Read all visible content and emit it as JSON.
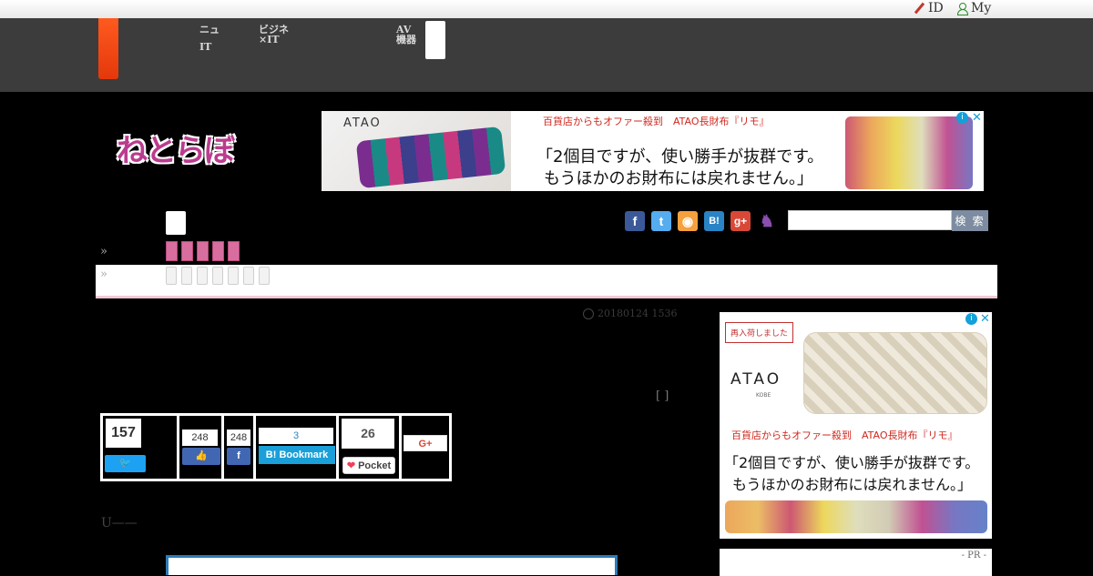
{
  "topbar": {
    "id_link": "ID",
    "my_link": "My"
  },
  "nav": {
    "items": [
      {
        "line1": "ニュ",
        "line2": "IT"
      },
      {
        "line1": "ビジネ",
        "line2": "×IT"
      },
      {
        "line1": "AV",
        "line2": "機器"
      }
    ]
  },
  "logo": {
    "text": "ねとらぼ"
  },
  "ad_top": {
    "brand": "ATAO",
    "headline": "百貨店からもオファー殺到　ATAO長財布『リモ』",
    "copy_line1": "「2個目ですが、使い勝手が抜群です。",
    "copy_line2": "もうほかのお財布には戻れません。」"
  },
  "breadcrumb": {
    "arrow": "»"
  },
  "search": {
    "button_label": "検 索",
    "placeholder": ""
  },
  "social_icons": [
    {
      "name": "facebook",
      "glyph": "f",
      "color": "#3b5998"
    },
    {
      "name": "twitter",
      "glyph": "t",
      "color": "#55acee"
    },
    {
      "name": "rss",
      "glyph": "◉",
      "color": "#f5a13e"
    },
    {
      "name": "hatena",
      "glyph": "B!",
      "color": "#2a83c5"
    },
    {
      "name": "google-plus",
      "glyph": "g+",
      "color": "#d94836"
    },
    {
      "name": "mascot",
      "glyph": "♞",
      "color": "#8a4fb0"
    }
  ],
  "article": {
    "date": "20180124 1536",
    "bracket": "[ ]",
    "lead": "U——"
  },
  "share": {
    "tweet_count": "157",
    "like_count": "248",
    "fb_share_count": "248",
    "bookmark_count": "3",
    "bookmark_label": "Bookmark",
    "pocket_count": "26",
    "pocket_label": "Pocket",
    "gplus_label": "G+"
  },
  "ad_side": {
    "tag": "再入荷しました",
    "brand": "ATAO",
    "brand_sub": "KOBE",
    "headline": "百貨店からもオファー殺到　ATAO長財布『リモ』",
    "copy_line1": "「2個目ですが、使い勝手が抜群です。",
    "copy_line2": "もうほかのお財布には戻れません。」"
  },
  "pr_label": "- PR -"
}
